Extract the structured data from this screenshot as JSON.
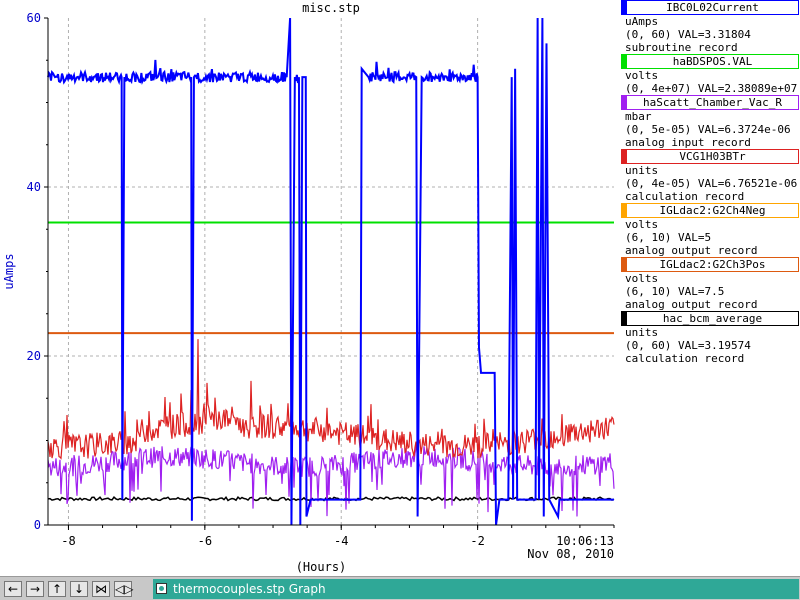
{
  "chart_data": {
    "type": "line",
    "title": "misc.stp",
    "xlabel": "(Hours)",
    "ylabel": "uAmps",
    "xlim": [
      -8.3,
      0
    ],
    "ylim": [
      0,
      60
    ],
    "x_ticks": [
      -8,
      -6,
      -4,
      -2
    ],
    "x_tick_labels": [
      "-8",
      "-6",
      "-4",
      "-2"
    ],
    "y_ticks": [
      0,
      20,
      40,
      60
    ],
    "y_tick_labels": [
      "0",
      "20",
      "40",
      "60"
    ],
    "end_time_label": "10:06:13",
    "end_date_label": "Nov 08, 2010",
    "grid": true,
    "series": [
      {
        "name": "IBC0L02Current",
        "color": "#0000ff",
        "baseline": 53,
        "points": [
          [
            -8.3,
            53
          ],
          [
            -7.22,
            53
          ],
          [
            -7.21,
            3
          ],
          [
            -7.18,
            53
          ],
          [
            -6.2,
            53
          ],
          [
            -6.19,
            0.5
          ],
          [
            -6.16,
            53
          ],
          [
            -4.8,
            53
          ],
          [
            -4.75,
            60
          ],
          [
            -4.73,
            0
          ],
          [
            -4.68,
            53
          ],
          [
            -4.62,
            53
          ],
          [
            -4.6,
            0
          ],
          [
            -4.57,
            53
          ],
          [
            -4.52,
            53
          ],
          [
            -4.51,
            1
          ],
          [
            -4.45,
            3
          ],
          [
            -4.2,
            3
          ],
          [
            -4.15,
            3
          ],
          [
            -4.1,
            3
          ],
          [
            -3.8,
            3
          ],
          [
            -3.72,
            3
          ],
          [
            -3.7,
            54
          ],
          [
            -3.6,
            53
          ],
          [
            -2.9,
            53
          ],
          [
            -2.88,
            1
          ],
          [
            -2.82,
            53
          ],
          [
            -2.0,
            53
          ],
          [
            -1.98,
            21
          ],
          [
            -1.95,
            18
          ],
          [
            -1.75,
            18
          ],
          [
            -1.73,
            0
          ],
          [
            -1.68,
            3
          ],
          [
            -1.55,
            3
          ],
          [
            -1.5,
            53
          ],
          [
            -1.48,
            3
          ],
          [
            -1.45,
            54
          ],
          [
            -1.42,
            3
          ],
          [
            -1.3,
            3
          ],
          [
            -1.15,
            3
          ],
          [
            -1.12,
            60
          ],
          [
            -1.1,
            3
          ],
          [
            -1.05,
            60
          ],
          [
            -1.03,
            1
          ],
          [
            -0.99,
            57
          ],
          [
            -0.95,
            3
          ],
          [
            -0.82,
            1
          ],
          [
            -0.8,
            3
          ],
          [
            -0.6,
            3
          ],
          [
            -0.55,
            3
          ],
          [
            -0.5,
            3
          ],
          [
            -0.3,
            3
          ],
          [
            -0.25,
            3
          ],
          [
            0,
            3
          ]
        ]
      },
      {
        "name": "haBDSPOS.VAL",
        "color": "#00e000",
        "values_constant": 35.8
      },
      {
        "name": "haScatt_Chamber_Vac_R",
        "color": "#a020f0",
        "baseline": 7.5
      },
      {
        "name": "VCG1H03BTr",
        "color": "#dd2222",
        "baseline": 10.5
      },
      {
        "name": "IGLdac2:G2Ch4Neg",
        "color": "#ffa500",
        "values_constant": null
      },
      {
        "name": "IGLdac2:G2Ch3Pos",
        "color": "#dd5a10",
        "values_constant": 22.7
      },
      {
        "name": "hac_bcm_average",
        "color": "#000000",
        "baseline": 3.1
      }
    ]
  },
  "legend": {
    "entries": [
      {
        "name": "IBC0L02Current",
        "color": "#0000ff",
        "unit": "uAmps",
        "range": "(0, 60) VAL=3.31804",
        "record": "subroutine record"
      },
      {
        "name": "haBDSPOS.VAL",
        "color": "#00e000",
        "unit": "volts",
        "range": "(0, 4e+07) VAL=2.38089e+07",
        "record": ""
      },
      {
        "name": "haScatt_Chamber_Vac_R",
        "color": "#a020f0",
        "unit": "mbar",
        "range": "(0, 5e-05) VAL=6.3724e-06",
        "record": "analog input record"
      },
      {
        "name": "VCG1H03BTr",
        "color": "#dd2222",
        "unit": "units",
        "range": "(0, 4e-05) VAL=6.76521e-06",
        "record": "calculation record"
      },
      {
        "name": "IGLdac2:G2Ch4Neg",
        "color": "#ffa500",
        "unit": "volts",
        "range": "(6, 10) VAL=5",
        "record": "analog output record"
      },
      {
        "name": "IGLdac2:G2Ch3Pos",
        "color": "#dd5a10",
        "unit": "volts",
        "range": "(6, 10) VAL=7.5",
        "record": "analog output record"
      },
      {
        "name": "hac_bcm_average",
        "color": "#000000",
        "unit": "units",
        "range": "(0, 60) VAL=3.19574",
        "record": "calculation record"
      }
    ]
  },
  "taskbar": {
    "buttons": [
      {
        "name": "first-icon",
        "glyph": "←"
      },
      {
        "name": "next-icon",
        "glyph": "→"
      },
      {
        "name": "up-icon",
        "glyph": "↑"
      },
      {
        "name": "down-icon",
        "glyph": "↓"
      },
      {
        "name": "collapse-icon",
        "glyph": "⋈"
      },
      {
        "name": "expand-icon",
        "glyph": "◁▷"
      }
    ],
    "tab_label": "thermocouples.stp Graph"
  }
}
